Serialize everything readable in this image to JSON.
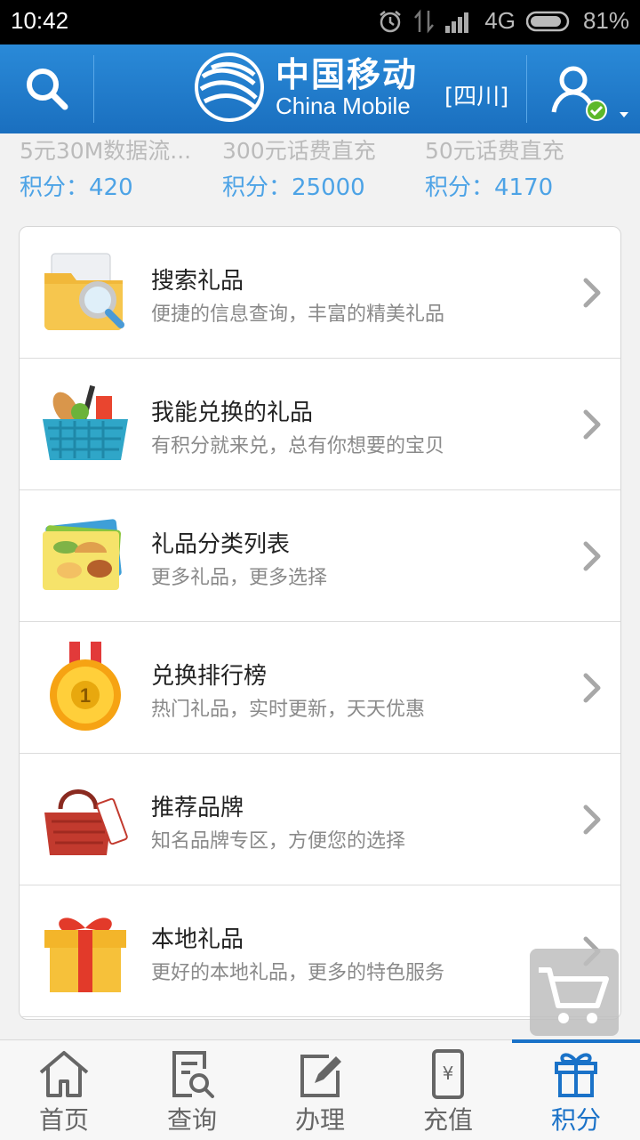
{
  "status_bar": {
    "time": "10:42",
    "network": "4G",
    "battery": "81%"
  },
  "header": {
    "brand_cn": "中国移动",
    "brand_en": "China Mobile",
    "region": "[四川]",
    "colors": {
      "bar": "#1a6fbf",
      "accent": "#1a72c8"
    }
  },
  "top_strip": [
    {
      "name": "5元30M数据流...",
      "points": "积分：420"
    },
    {
      "name": "300元话费直充",
      "points": "积分：25000"
    },
    {
      "name": "50元话费直充",
      "points": "积分：4170"
    }
  ],
  "menu": [
    {
      "title": "搜索礼品",
      "subtitle": "便捷的信息查询，丰富的精美礼品",
      "icon": "folder-search-icon"
    },
    {
      "title": "我能兑换的礼品",
      "subtitle": "有积分就来兑，总有你想要的宝贝",
      "icon": "basket-icon"
    },
    {
      "title": "礼品分类列表",
      "subtitle": "更多礼品，更多选择",
      "icon": "category-cards-icon"
    },
    {
      "title": "兑换排行榜",
      "subtitle": "热门礼品，实时更新，天天优惠",
      "icon": "medal-icon"
    },
    {
      "title": "推荐品牌",
      "subtitle": "知名品牌专区，方便您的选择",
      "icon": "handbag-icon"
    },
    {
      "title": "本地礼品",
      "subtitle": "更好的本地礼品，更多的特色服务",
      "icon": "gift-box-icon"
    }
  ],
  "tabs": [
    {
      "label": "首页",
      "icon": "home-icon"
    },
    {
      "label": "查询",
      "icon": "query-icon"
    },
    {
      "label": "办理",
      "icon": "edit-icon"
    },
    {
      "label": "充值",
      "icon": "recharge-icon"
    },
    {
      "label": "积分",
      "icon": "gift-icon"
    }
  ],
  "active_tab": "积分"
}
